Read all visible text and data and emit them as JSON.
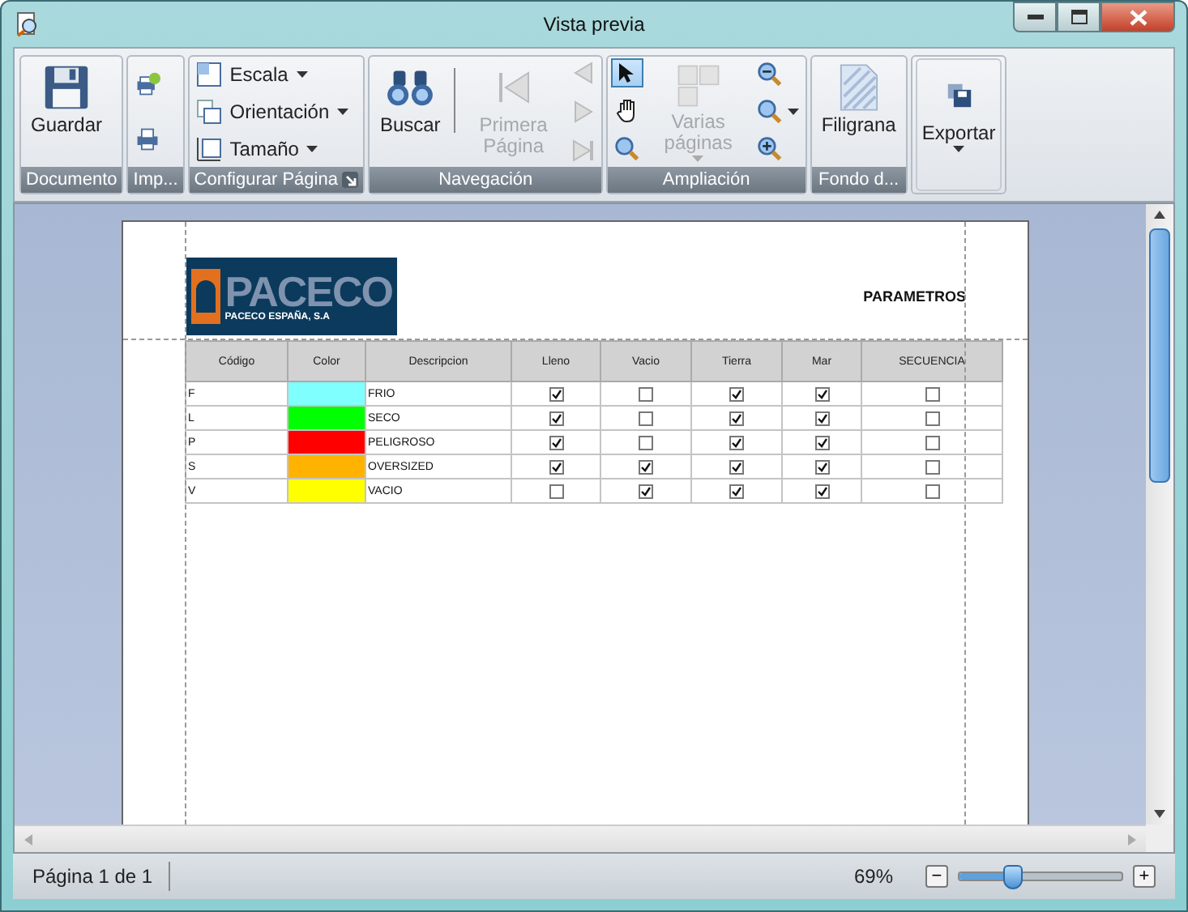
{
  "window": {
    "title": "Vista previa"
  },
  "ribbon": {
    "groups": [
      {
        "label": "Documento",
        "items": [
          {
            "kind": "large",
            "label": "Guardar"
          }
        ]
      },
      {
        "label": "Imp...",
        "items": [
          {
            "kind": "icononly"
          },
          {
            "kind": "icononly"
          }
        ]
      },
      {
        "label": "Configurar Página",
        "launcher": true,
        "items": [
          {
            "kind": "small",
            "label": "Escala",
            "dropdown": true
          },
          {
            "kind": "small",
            "label": "Orientación",
            "dropdown": true
          },
          {
            "kind": "small",
            "label": "Tamaño",
            "dropdown": true
          }
        ]
      },
      {
        "label": "Navegación",
        "items": [
          {
            "kind": "large",
            "label": "Buscar"
          },
          {
            "kind": "sep"
          },
          {
            "kind": "large",
            "label": "Primera Página",
            "disabled": true
          },
          {
            "kind": "navcol",
            "buttons": [
              {
                "disabled": true
              },
              {
                "disabled": true
              },
              {
                "disabled": true
              }
            ]
          }
        ]
      },
      {
        "label": "Ampliación",
        "items": [
          {
            "kind": "navcol",
            "buttons": [
              {
                "selected": true
              },
              {
                "selected": false
              },
              {
                "selected": false
              }
            ]
          },
          {
            "kind": "large",
            "label": "Varias páginas",
            "disabled": true,
            "dropdown": true
          },
          {
            "kind": "navcol",
            "buttons": [
              {
                "dropdown": false
              },
              {
                "dropdown": true
              },
              {
                "dropdown": false
              }
            ]
          }
        ]
      },
      {
        "label": "Fondo d...",
        "items": [
          {
            "kind": "large",
            "label": "Filigrana"
          }
        ]
      },
      {
        "items": [
          {
            "kind": "large",
            "label": "Exportar",
            "dropdown": true
          }
        ]
      }
    ]
  },
  "page": {
    "logo": {
      "name": "PACECO",
      "subtitle": "PACECO ESPAÑA, S.A"
    },
    "title": "PARAMETROS",
    "table": {
      "columns": [
        "Código",
        "Color",
        "Descripcion",
        "Lleno",
        "Vacio",
        "Tierra",
        "Mar",
        "SECUENCIA"
      ],
      "rows": [
        {
          "code": "F",
          "color": "#80ffff",
          "description": "FRIO",
          "lleno": true,
          "vacio": false,
          "tierra": true,
          "mar": true,
          "secuencia": false
        },
        {
          "code": "L",
          "color": "#00ff00",
          "description": "SECO",
          "lleno": true,
          "vacio": false,
          "tierra": true,
          "mar": true,
          "secuencia": false
        },
        {
          "code": "P",
          "color": "#ff0000",
          "description": "PELIGROSO",
          "lleno": true,
          "vacio": false,
          "tierra": true,
          "mar": true,
          "secuencia": false
        },
        {
          "code": "S",
          "color": "#ffb300",
          "description": "OVERSIZED",
          "lleno": true,
          "vacio": true,
          "tierra": true,
          "mar": true,
          "secuencia": false
        },
        {
          "code": "V",
          "color": "#ffff00",
          "description": "VACIO",
          "lleno": false,
          "vacio": true,
          "tierra": true,
          "mar": true,
          "secuencia": false
        }
      ]
    }
  },
  "status_bar": {
    "page": "Página 1 de 1",
    "zoom": "69%",
    "zoom_slider": {
      "level": 0.33
    },
    "zoom_out": "−",
    "zoom_in": "+"
  }
}
